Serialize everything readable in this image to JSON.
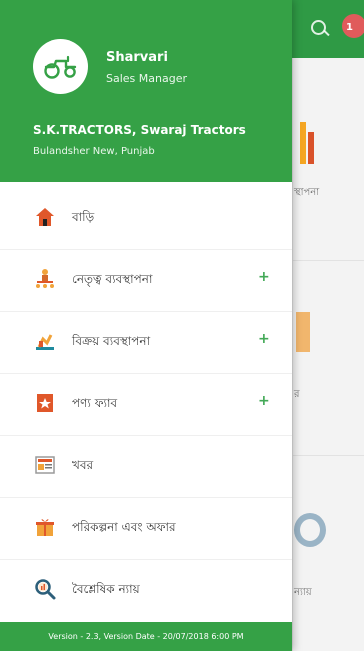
{
  "background": {
    "visible_labels": [
      "স্থাপনা",
      "ন্যায়"
    ],
    "notification_badge": "1"
  },
  "drawer": {
    "profile": {
      "name": "Sharvari",
      "role": "Sales Manager",
      "dealer": "S.K.TRACTORS, Swaraj Tractors",
      "location": "Bulandsher New, Punjab",
      "logo_icon": "tractor-icon"
    },
    "menu": [
      {
        "label": "বাড়ি",
        "icon": "home-icon",
        "has_plus": false
      },
      {
        "label": "নেতৃত্ব ব্যবস্থাপনা",
        "icon": "leadership-icon",
        "has_plus": true,
        "plus": "+"
      },
      {
        "label": "বিক্রয় ব্যবস্থাপনা",
        "icon": "sales-icon",
        "has_plus": true,
        "plus": "+"
      },
      {
        "label": "পণ্য ফ্যাব",
        "icon": "product-fab-icon",
        "has_plus": true,
        "plus": "+"
      },
      {
        "label": "খবর",
        "icon": "news-icon",
        "has_plus": false
      },
      {
        "label": "পরিকল্পনা এবং অফার",
        "icon": "gift-offer-icon",
        "has_plus": false
      },
      {
        "label": "বৈশ্লেষিক ন্যায়",
        "icon": "analytics-search-icon",
        "has_plus": false
      }
    ],
    "footer": "Version - 2.3, Version Date - 20/07/2018 6:00 PM"
  },
  "colors": {
    "primary_green": "#35a146",
    "plus_green": "#43a957",
    "text_dark": "#3b3b3b"
  }
}
